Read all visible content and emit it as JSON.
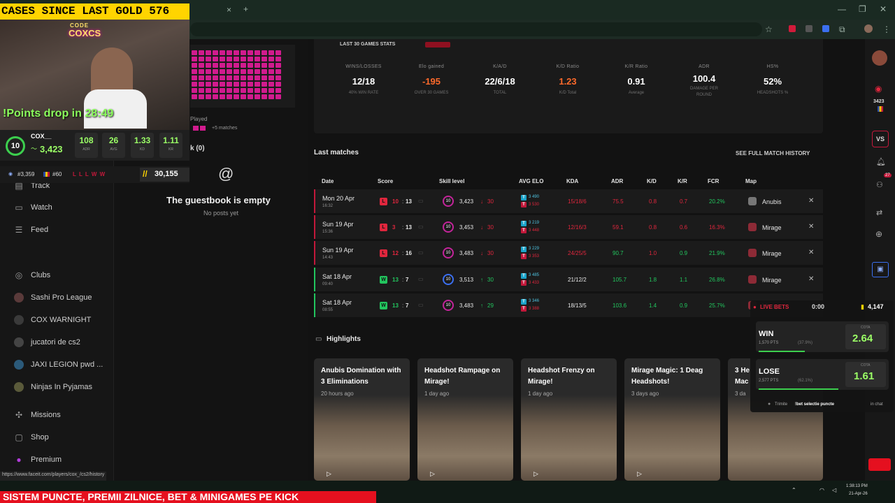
{
  "browser": {
    "new_tab": "+",
    "close_tab": "×",
    "window_min": "—",
    "window_max": "❐",
    "window_close": "✕"
  },
  "overlay": {
    "cases_banner": "CASES SINCE LAST GOLD   576",
    "points_drop": "!Points drop in 28:49",
    "player_name": "COX__",
    "player_elo": "3,423",
    "level": "10",
    "stats": [
      {
        "v": "108",
        "l": "ADR"
      },
      {
        "v": "26",
        "l": "AVG"
      },
      {
        "v": "1.33",
        "l": "KD"
      },
      {
        "v": "1.11",
        "l": "KR"
      }
    ],
    "rank_world": "#3,359",
    "rank_country": "#60",
    "last_results": "L L L W W",
    "points": "30,155",
    "bottom_banner": "SISTEM PUNCTE, PREMII ZILNICE, BET & MINIGAMES PE KICK",
    "webcam_sign_top": "CODE",
    "webcam_sign_bottom": "COXCS"
  },
  "sidebar": {
    "items_top": [
      {
        "label": "Track",
        "icon": "track-icon"
      },
      {
        "label": "Watch",
        "icon": "watch-icon"
      },
      {
        "label": "Feed",
        "icon": "feed-icon"
      }
    ],
    "clubs_label": "Clubs",
    "clubs": [
      "Sashi Pro League",
      "COX WARNIGHT",
      "jucatori de cs2",
      "JAXI LEGION pwd ...",
      "Ninjas In Pyjamas"
    ],
    "items_bottom": [
      {
        "label": "Missions",
        "icon": "missions-icon"
      },
      {
        "label": "Shop",
        "icon": "shop-icon"
      },
      {
        "label": "Premium",
        "icon": "premium-icon"
      }
    ]
  },
  "profile": {
    "played_label": "Played",
    "matches_more": "+5 matches",
    "guestbook_tab": "k (0)",
    "guestbook_title": "The guestbook is empty",
    "guestbook_sub": "No posts yet"
  },
  "stats": {
    "title": "LAST 30 GAMES STATS",
    "items": [
      {
        "label": "WINS/LOSSES",
        "value": "12/18",
        "sub": "40% WIN RATE",
        "color": "#ffffff"
      },
      {
        "label": "Elo gained",
        "value": "-195",
        "sub": "OVER 30 GAMES",
        "color": "#ff6a2b"
      },
      {
        "label": "K/A/D",
        "value": "22/6/18",
        "sub": "TOTAL",
        "color": "#ffffff"
      },
      {
        "label": "K/D Ratio",
        "value": "1.23",
        "sub": "K/D Total",
        "color": "#ff6a2b"
      },
      {
        "label": "K/R Ratio",
        "value": "0.91",
        "sub": "Average",
        "color": "#ffffff"
      },
      {
        "label": "ADR",
        "value": "100.4",
        "sub": "DAMAGE PER ROUND",
        "color": "#ffffff"
      },
      {
        "label": "HS%",
        "value": "52%",
        "sub": "HEADSHOTS %",
        "color": "#ffffff"
      }
    ]
  },
  "matches": {
    "title": "Last matches",
    "see_all": "SEE FULL MATCH HISTORY",
    "headers": [
      "Date",
      "Score",
      "Skill level",
      "AVG ELO",
      "KDA",
      "ADR",
      "K/D",
      "K/R",
      "FCR",
      "Map"
    ],
    "rows": [
      {
        "day": "Mon 20 Apr",
        "time": "16:32",
        "result": "L",
        "s1": "10",
        "s2": "13",
        "lvl": "10",
        "elo": "3,423",
        "delta": "30",
        "t1": "3 490",
        "t2": "3 530",
        "kda": "15/18/6",
        "adr": "75.5",
        "kd": "0.8",
        "kr": "0.7",
        "fcr": "20.2%",
        "map": "Anubis",
        "win": false
      },
      {
        "day": "Sun 19 Apr",
        "time": "15:36",
        "result": "L",
        "s1": "3",
        "s2": "13",
        "lvl": "10",
        "elo": "3,453",
        "delta": "30",
        "t1": "3 219",
        "t2": "3 448",
        "kda": "12/16/3",
        "adr": "59.1",
        "kd": "0.8",
        "kr": "0.6",
        "fcr": "16.3%",
        "map": "Mirage",
        "win": false
      },
      {
        "day": "Sun 19 Apr",
        "time": "14:43",
        "result": "L",
        "s1": "12",
        "s2": "16",
        "lvl": "10",
        "elo": "3,483",
        "delta": "30",
        "t1": "3 229",
        "t2": "3 353",
        "kda": "24/25/5",
        "adr": "90.7",
        "kd": "1.0",
        "kr": "0.9",
        "fcr": "21.9%",
        "map": "Mirage",
        "win": false
      },
      {
        "day": "Sat 18 Apr",
        "time": "09:40",
        "result": "W",
        "s1": "13",
        "s2": "7",
        "lvl": "10",
        "elo": "3,513",
        "delta": "30",
        "t1": "3 485",
        "t2": "3 433",
        "kda": "21/12/2",
        "adr": "105.7",
        "kd": "1.8",
        "kr": "1.1",
        "fcr": "26.8%",
        "map": "Mirage",
        "win": true
      },
      {
        "day": "Sat 18 Apr",
        "time": "08:55",
        "result": "W",
        "s1": "13",
        "s2": "7",
        "lvl": "10",
        "elo": "3,483",
        "delta": "29",
        "t1": "3 346",
        "t2": "3 388",
        "kda": "18/13/5",
        "adr": "103.6",
        "kd": "1.4",
        "kr": "0.9",
        "fcr": "25.7%",
        "map": "Mirage",
        "win": true
      }
    ]
  },
  "highlights": {
    "title": "Highlights",
    "items": [
      {
        "title": "Anubis Domination with 3 Eliminations",
        "age": "20 hours ago"
      },
      {
        "title": "Headshot Rampage on Mirage!",
        "age": "1 day ago"
      },
      {
        "title": "Headshot Frenzy on Mirage!",
        "age": "1 day ago"
      },
      {
        "title": "Mirage Magic: 1 Deag Headshots!",
        "age": "3 days ago"
      },
      {
        "title": "3 He Mac",
        "age": "3 da"
      }
    ]
  },
  "bets": {
    "live_label": "LIVE BETS",
    "timer": "0:00",
    "balance": "4,147",
    "win_label": "WIN",
    "win_pts": "1,570 PTS",
    "win_pct": "(37.9%)",
    "win_odds": "2.64",
    "lose_label": "LOSE",
    "lose_pts": "2,577 PTS",
    "lose_pct": "(62.1%)",
    "lose_odds": "1.61",
    "odds_caption": "COTA",
    "footer_a": "Trimite",
    "footer_cmd": "!bet selectie puncte",
    "footer_b": "in chat"
  },
  "rightbar": {
    "elo": "3423",
    "vs": "VS",
    "notif_badge": "27"
  },
  "statusbar": {
    "url": "https://www.faceit.com/players/cox_/cs2/history"
  },
  "taskbar": {
    "time": "1:38:13 PM",
    "date": "21-Apr-26"
  }
}
